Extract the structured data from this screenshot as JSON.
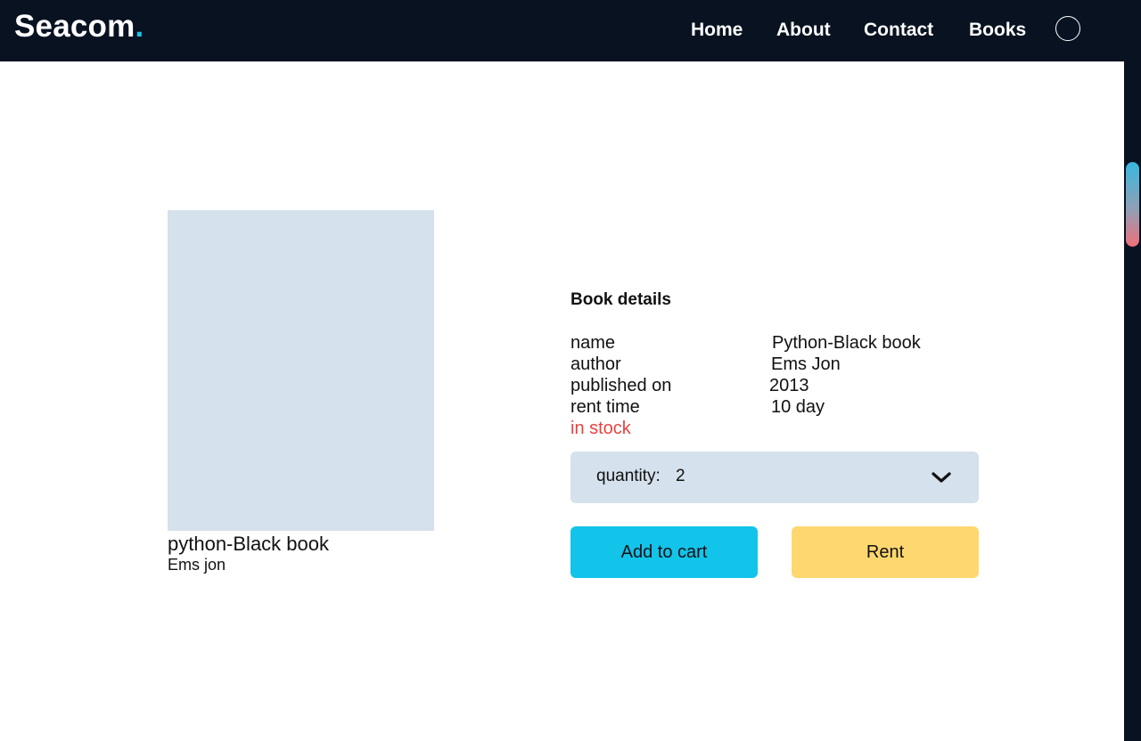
{
  "brand": {
    "name": "Seacom",
    "dot": "."
  },
  "nav": {
    "items": [
      "Home",
      "About",
      "Contact",
      "Books"
    ]
  },
  "book": {
    "cover_title": "python-Black book",
    "cover_author": "Ems jon"
  },
  "details": {
    "heading": "Book details",
    "rows": [
      {
        "label": "name",
        "value": "Python-Black book"
      },
      {
        "label": "author",
        "value": "Ems Jon"
      },
      {
        "label": "published on",
        "value": "2013"
      },
      {
        "label": "rent time",
        "value": "10 day"
      }
    ],
    "stock_status": "in stock"
  },
  "quantity": {
    "label": "quantity:",
    "value": "2"
  },
  "actions": {
    "add_to_cart": "Add to cart",
    "rent": "Rent"
  },
  "icons": {
    "avatar": "user-avatar-icon",
    "dropdown": "chevron-down-icon"
  },
  "colors": {
    "navbar": "#081221",
    "accent": "#16c4e8",
    "cart_button": "#12c3ea",
    "rent_button": "#fed86f",
    "stock": "#e8423f",
    "cover": "#d5e1ec"
  }
}
